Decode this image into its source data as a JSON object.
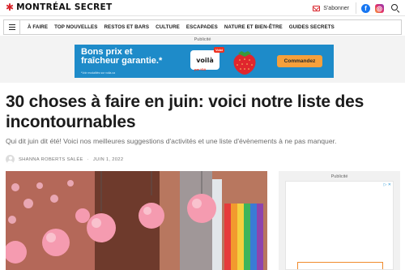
{
  "header": {
    "logo_text": "MONTRÉAL SECRET",
    "subscribe_label": "S'abonner"
  },
  "nav": {
    "items": [
      "À FAIRE",
      "TOP NOUVELLES",
      "RESTOS ET BARS",
      "CULTURE",
      "ESCAPADES",
      "NATURE ET BIEN-ÊTRE",
      "GUIDES SECRETS"
    ]
  },
  "ad_banner": {
    "label": "Publicité",
    "headline_line1": "Bons prix et",
    "headline_line2": "fraîcheur garantie.*",
    "fineprint": "*Voir modalités sur voila.ca",
    "brand": "voilà",
    "brand_sub": "par IGA",
    "brand_tag": "Voici",
    "cta": "Commandez"
  },
  "article": {
    "title": "30 choses à faire en juin: voici notre liste des incontournables",
    "subtitle": "Qui dit juin dit été! Voici nos meilleures suggestions d'activités et une liste d'évènements à ne pas manquer.",
    "author": "SHANNA ROBERTS SALÉE",
    "date": "JUIN 1, 2022"
  },
  "sidebar": {
    "ad_label": "Publicité",
    "adchoice": "▷ ✕"
  },
  "colors": {
    "brand_red": "#d8232a",
    "banner_blue": "#1e8bc9",
    "cta_orange": "#f6a03b"
  }
}
